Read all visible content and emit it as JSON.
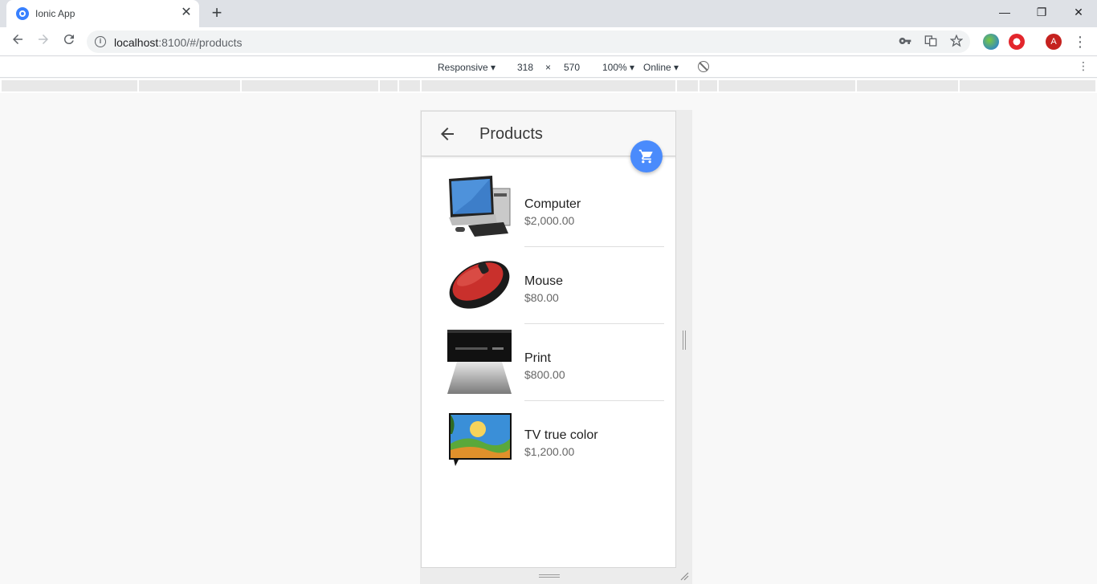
{
  "browser": {
    "tab_title": "Ionic App",
    "tab_close": "✕",
    "new_tab": "+",
    "window_controls": {
      "minimize": "—",
      "restore": "❐",
      "close": "✕"
    },
    "url_host": "localhost",
    "url_rest": ":8100/#/products",
    "profile_initial": "A"
  },
  "device_toolbar": {
    "mode": "Responsive ▾",
    "width": "318",
    "times": "×",
    "height": "570",
    "zoom": "100% ▾",
    "network": "Online ▾"
  },
  "app": {
    "title": "Products",
    "products": [
      {
        "name": "Computer",
        "price": "$2,000.00",
        "image": "computer"
      },
      {
        "name": "Mouse",
        "price": "$80.00",
        "image": "mouse"
      },
      {
        "name": "Print",
        "price": "$800.00",
        "image": "printer"
      },
      {
        "name": "TV true color",
        "price": "$1,200.00",
        "image": "tv"
      }
    ]
  },
  "colors": {
    "fab": "#4a8bfc",
    "header_bg": "#f7f7f7",
    "favicon": "#3880ff",
    "profile": "#c5221f"
  }
}
